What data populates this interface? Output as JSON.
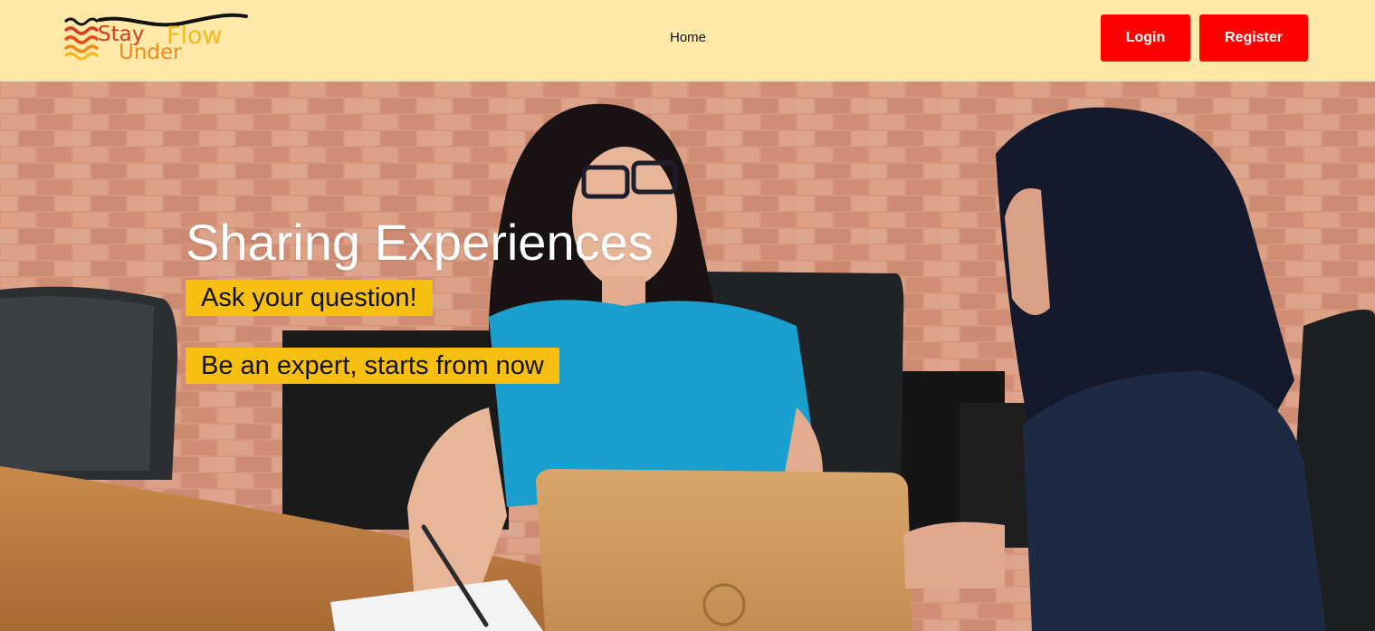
{
  "logo": {
    "words": {
      "stay": "Stay",
      "flow": "Flow",
      "under": "Under"
    },
    "colors": {
      "stay": "#d83a1c",
      "flow": "#f6b818",
      "under": "#f08a1a",
      "swoosh": "#111111"
    }
  },
  "nav": {
    "home_label": "Home"
  },
  "auth": {
    "login_label": "Login",
    "register_label": "Register"
  },
  "hero": {
    "title": "Sharing Experiences",
    "tagline_1": "Ask your question!",
    "tagline_2": "Be an expert, starts from now",
    "image_icon": "hero-photo-image"
  },
  "colors": {
    "header_bg": "#ffe9a8",
    "button_bg": "#ff0000",
    "tag_bg": "#f6bf12",
    "title_text": "#ffffff"
  }
}
